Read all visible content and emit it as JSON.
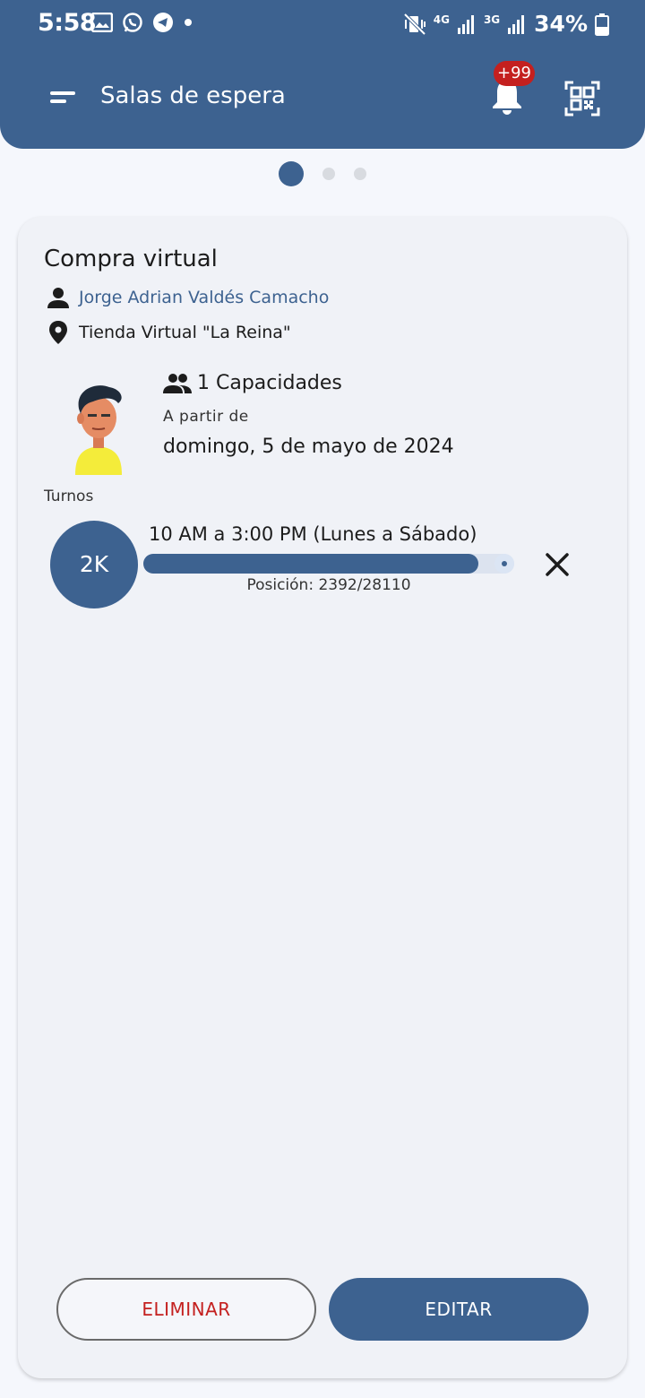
{
  "status_bar": {
    "time": "5:58",
    "battery": "34%",
    "net_4g": "4G",
    "net_3g": "3G"
  },
  "app_bar": {
    "title": "Salas de espera",
    "notification_badge": "+99",
    "icons": [
      "menu-icon",
      "bell-icon",
      "qr-scan-icon"
    ]
  },
  "pager": {
    "count": 3,
    "active_index": 0
  },
  "card": {
    "title": "Compra virtual",
    "owner_name": "Jorge Adrian Valdés Camacho",
    "store_name": "Tienda Virtual \"La Reina\"",
    "capacity": "1 Capacidades",
    "from_label": "A partir de",
    "date": "domingo, 5 de mayo de 2024",
    "turnos_label": "Turnos",
    "turn": {
      "badge": "2K",
      "range": "10 AM a 3:00 PM (Lunes a Sábado)",
      "position_text": "Posición: 2392/28110",
      "progress_fraction": 0.955
    }
  },
  "actions": {
    "delete_label": "ELIMINAR",
    "edit_label": "EDITAR"
  },
  "colors": {
    "primary": "#3d6290",
    "danger": "#c4201f",
    "card_bg": "#f0f2f7",
    "page_bg": "#f5f7fc"
  }
}
